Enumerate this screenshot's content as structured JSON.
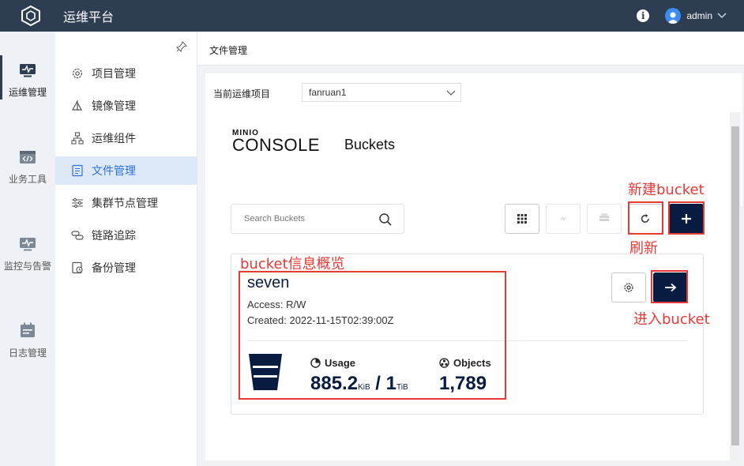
{
  "topbar": {
    "app_title": "运维平台",
    "user": "admin",
    "icons": [
      "cube-logo-icon",
      "info-icon",
      "user-avatar-icon",
      "chevron-down-icon"
    ]
  },
  "rail": {
    "items": [
      {
        "label": "运维管理",
        "icon": "monitor-icon",
        "active": true
      },
      {
        "label": "业务工具",
        "icon": "code-window-icon",
        "active": false
      },
      {
        "label": "监控与告警",
        "icon": "monitor-alert-icon",
        "active": false
      },
      {
        "label": "日志管理",
        "icon": "calendar-log-icon",
        "active": false
      }
    ]
  },
  "menu": {
    "items": [
      {
        "label": "项目管理",
        "icon": "gear-icon",
        "active": false
      },
      {
        "label": "镜像管理",
        "icon": "sail-icon",
        "active": false
      },
      {
        "label": "运维组件",
        "icon": "hierarchy-icon",
        "active": false
      },
      {
        "label": "文件管理",
        "icon": "file-icon",
        "active": true
      },
      {
        "label": "集群节点管理",
        "icon": "sliders-icon",
        "active": false
      },
      {
        "label": "链路追踪",
        "icon": "link-icon",
        "active": false
      },
      {
        "label": "备份管理",
        "icon": "backup-icon",
        "active": false
      }
    ]
  },
  "breadcrumb": "文件管理",
  "project": {
    "label": "当前运维项目",
    "value": "fanruan1"
  },
  "console": {
    "logo_small": "MINIO",
    "logo_big": "CONSOLE",
    "title": "Buckets"
  },
  "search": {
    "placeholder": "Search Buckets",
    "value": ""
  },
  "toolbar": {
    "buttons": [
      "grid-view-icon",
      "sync-icon",
      "stack-icon",
      "refresh-icon",
      "plus-icon"
    ]
  },
  "bucket": {
    "name": "seven",
    "access": "Access: R/W",
    "created": "Created: 2022-11-15T02:39:00Z",
    "usage_label": "Usage",
    "usage_value": "885.2",
    "usage_unit": "KiB",
    "usage_sep": " / ",
    "quota_value": "1",
    "quota_unit": "TiB",
    "objects_label": "Objects",
    "objects_value": "1,789"
  },
  "annotations": {
    "new_bucket": "新建bucket",
    "refresh": "刷新",
    "bucket_overview": "bucket信息概览",
    "enter_bucket": "进入bucket"
  },
  "colors": {
    "topbar": "#2e3d52",
    "primary_dark": "#081c42",
    "menu_active_bg": "#dde8f9",
    "menu_active_text": "#2f6fde",
    "annotation_red": "#e53935"
  }
}
